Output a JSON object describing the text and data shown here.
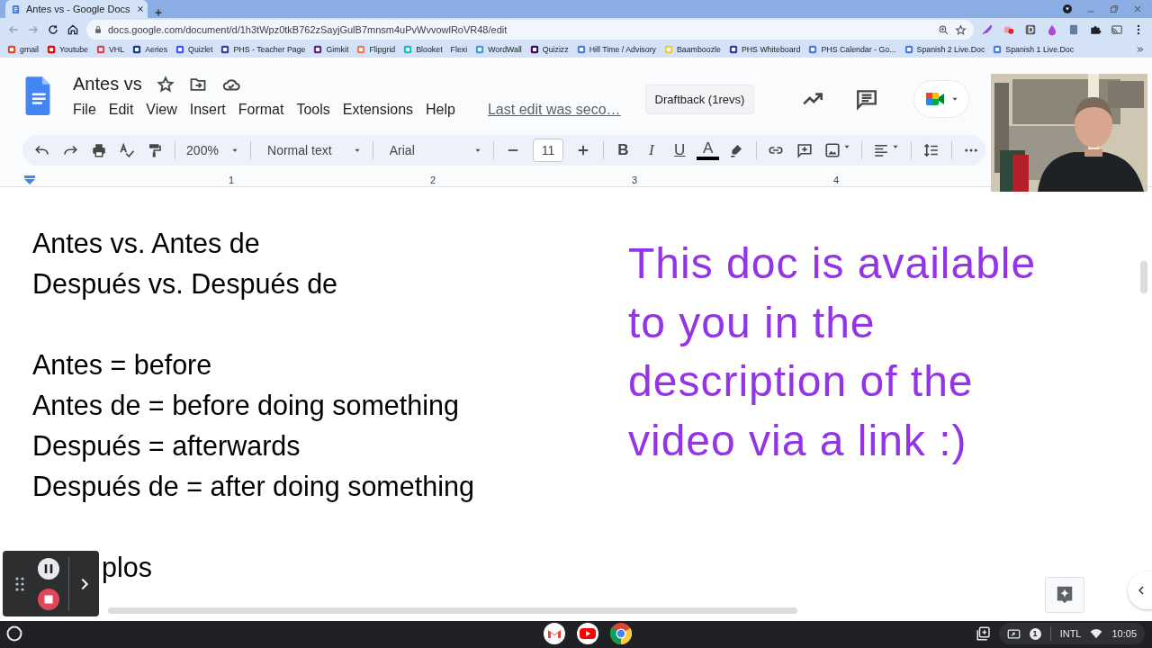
{
  "browser": {
    "tabs": [
      {
        "title": "Antes vs - Google Docs",
        "selected": true
      }
    ],
    "url": "docs.google.com/document/d/1h3tWpz0tkB762zSayjGulB7mnsm4uPvWvvowlRoVR48/edit",
    "bookmarks": [
      {
        "label": "gmail",
        "color": "#ea4335"
      },
      {
        "label": "Youtube",
        "color": "#ff0000"
      },
      {
        "label": "VHL",
        "color": "#e5405e"
      },
      {
        "label": "Aeries",
        "color": "#1a3d8f"
      },
      {
        "label": "Quizlet",
        "color": "#4255ff"
      },
      {
        "label": "PHS - Teacher Page",
        "color": "#3c3fa0"
      },
      {
        "label": "Gimkit",
        "color": "#5b2a86"
      },
      {
        "label": "Flipgrid",
        "color": "#f07a5a"
      },
      {
        "label": "Blooket",
        "color": "#15c2c2"
      },
      {
        "label": "Flexi"
      },
      {
        "label": "WordWall",
        "color": "#3aa0e0"
      },
      {
        "label": "Quizizz",
        "color": "#460a5a"
      },
      {
        "label": "Hill Time / Advisory",
        "color": "#4a7fe0"
      },
      {
        "label": "Baamboozle",
        "color": "#f6c945"
      },
      {
        "label": "PHS Whiteboard",
        "color": "#3c3fa0"
      },
      {
        "label": "PHS Calendar - Go...",
        "color": "#4a7fe0"
      },
      {
        "label": "Spanish 2 Live.Doc",
        "color": "#4a7fe0"
      },
      {
        "label": "Spanish 1 Live.Doc",
        "color": "#4a7fe0"
      }
    ]
  },
  "docs": {
    "title": "Antes vs",
    "menu": [
      "File",
      "Edit",
      "View",
      "Insert",
      "Format",
      "Tools",
      "Extensions",
      "Help"
    ],
    "last_edit": "Last edit was seco…",
    "draftback": "Draftback (1revs)",
    "toolbar": {
      "zoom": "200%",
      "style": "Normal text",
      "font": "Arial",
      "size": "11",
      "bold": "B",
      "italic": "I",
      "underline": "U",
      "text_color": "A"
    },
    "ruler": [
      "1",
      "2",
      "3",
      "4"
    ],
    "left_blocks": [
      [
        "Antes vs. Antes de",
        "Después vs. Después de"
      ],
      [
        "Antes = before",
        "Antes de = before doing something",
        "Después = afterwards",
        "Después de = after doing something"
      ],
      [
        "plos"
      ]
    ],
    "right_lines": [
      "This doc is available",
      "to you in the",
      "description of the",
      "video via a link :)"
    ]
  },
  "shelf": {
    "tray_count": "1",
    "keyboard": "INTL",
    "time": "10:05"
  }
}
